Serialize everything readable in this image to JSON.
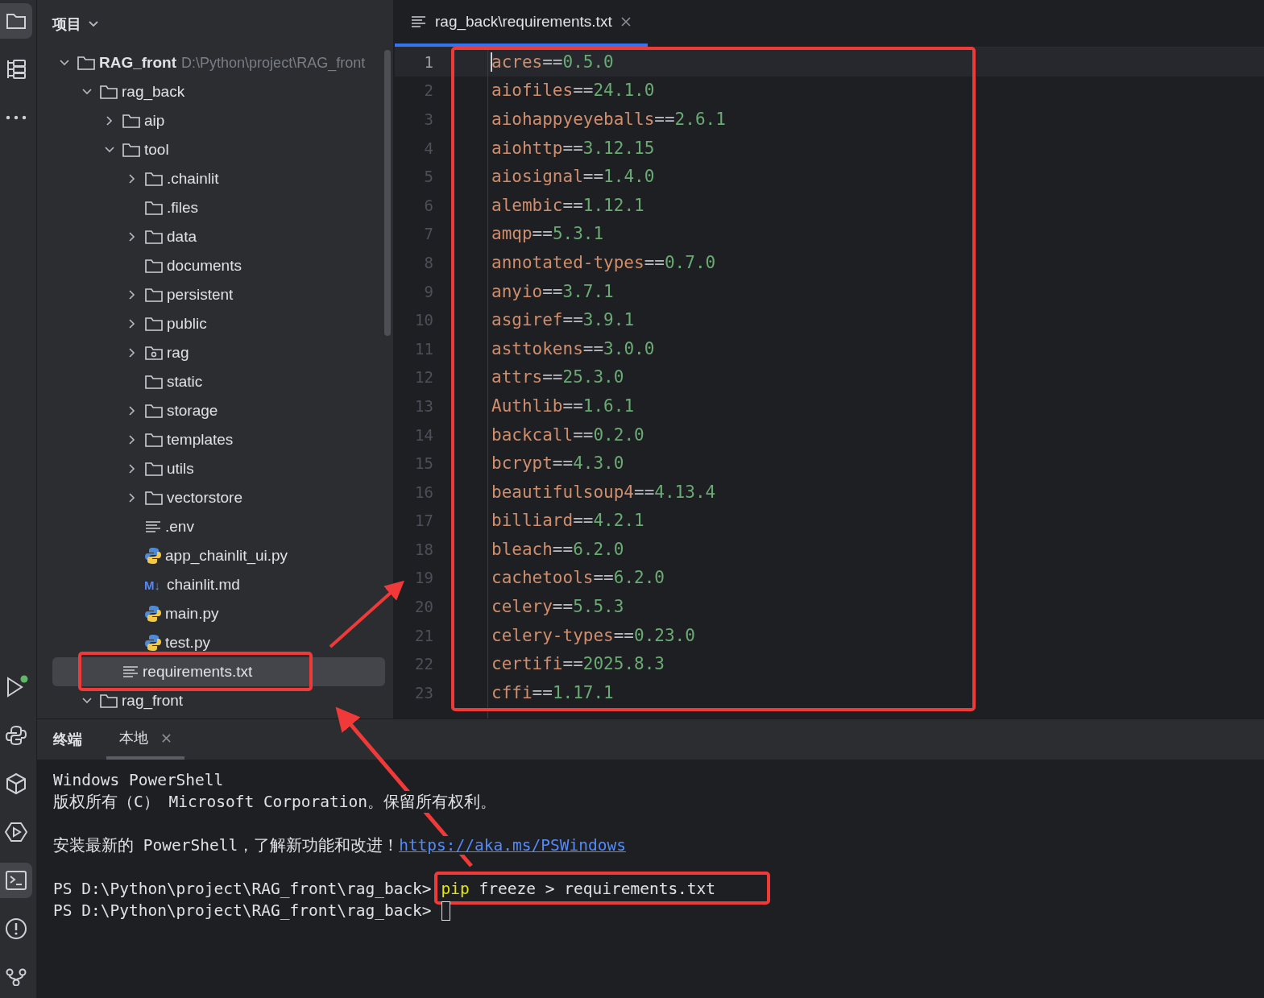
{
  "project_panel": {
    "title": "项目",
    "tree": [
      {
        "name": "RAG_front",
        "path": "D:\\Python\\project\\RAG_front",
        "kind": "folder",
        "expanded": true,
        "selected": false,
        "children": [
          {
            "name": "rag_back",
            "kind": "folder",
            "expanded": true,
            "selected": false,
            "children": [
              {
                "name": "aip",
                "kind": "folder",
                "expanded": false,
                "selected": false
              },
              {
                "name": "tool",
                "kind": "folder",
                "expanded": true,
                "selected": false,
                "children": [
                  {
                    "name": ".chainlit",
                    "kind": "folder",
                    "expanded": false,
                    "selected": false
                  },
                  {
                    "name": ".files",
                    "kind": "folder",
                    "selected": false
                  },
                  {
                    "name": "data",
                    "kind": "folder",
                    "expanded": false,
                    "selected": false
                  },
                  {
                    "name": "documents",
                    "kind": "folder",
                    "selected": false
                  },
                  {
                    "name": "persistent",
                    "kind": "folder",
                    "expanded": false,
                    "selected": false
                  },
                  {
                    "name": "public",
                    "kind": "folder",
                    "expanded": false,
                    "selected": false
                  },
                  {
                    "name": "rag",
                    "kind": "package",
                    "expanded": false,
                    "selected": false
                  },
                  {
                    "name": "static",
                    "kind": "folder",
                    "selected": false
                  },
                  {
                    "name": "storage",
                    "kind": "folder",
                    "expanded": false,
                    "selected": false
                  },
                  {
                    "name": "templates",
                    "kind": "folder",
                    "expanded": false,
                    "selected": false
                  },
                  {
                    "name": "utils",
                    "kind": "folder",
                    "expanded": false,
                    "selected": false
                  },
                  {
                    "name": "vectorstore",
                    "kind": "folder",
                    "expanded": false,
                    "selected": false
                  },
                  {
                    "name": ".env",
                    "kind": "text",
                    "selected": false
                  },
                  {
                    "name": "app_chainlit_ui.py",
                    "kind": "python",
                    "selected": false
                  },
                  {
                    "name": "chainlit.md",
                    "kind": "markdown",
                    "badge": "M↓",
                    "selected": false
                  },
                  {
                    "name": "main.py",
                    "kind": "python",
                    "selected": false
                  },
                  {
                    "name": "test.py",
                    "kind": "python",
                    "selected": false
                  }
                ]
              },
              {
                "name": "requirements.txt",
                "kind": "text",
                "selected": true
              }
            ]
          },
          {
            "name": "rag_front",
            "kind": "folder",
            "expanded": true,
            "selected": false
          }
        ]
      }
    ]
  },
  "editor": {
    "tabs": [
      {
        "label": "rag_back\\requirements.txt",
        "selected": true
      }
    ],
    "lines": [
      {
        "number": "1",
        "package": "acres",
        "operator": "==",
        "version": "0.5.0",
        "current": true
      },
      {
        "number": "2",
        "package": "aiofiles",
        "operator": "==",
        "version": "24.1.0"
      },
      {
        "number": "3",
        "package": "aiohappyeyeballs",
        "operator": "==",
        "version": "2.6.1"
      },
      {
        "number": "4",
        "package": "aiohttp",
        "operator": "==",
        "version": "3.12.15"
      },
      {
        "number": "5",
        "package": "aiosignal",
        "operator": "==",
        "version": "1.4.0"
      },
      {
        "number": "6",
        "package": "alembic",
        "operator": "==",
        "version": "1.12.1"
      },
      {
        "number": "7",
        "package": "amqp",
        "operator": "==",
        "version": "5.3.1"
      },
      {
        "number": "8",
        "package": "annotated-types",
        "operator": "==",
        "version": "0.7.0"
      },
      {
        "number": "9",
        "package": "anyio",
        "operator": "==",
        "version": "3.7.1"
      },
      {
        "number": "10",
        "package": "asgiref",
        "operator": "==",
        "version": "3.9.1"
      },
      {
        "number": "11",
        "package": "asttokens",
        "operator": "==",
        "version": "3.0.0"
      },
      {
        "number": "12",
        "package": "attrs",
        "operator": "==",
        "version": "25.3.0"
      },
      {
        "number": "13",
        "package": "Authlib",
        "operator": "==",
        "version": "1.6.1"
      },
      {
        "number": "14",
        "package": "backcall",
        "operator": "==",
        "version": "0.2.0"
      },
      {
        "number": "15",
        "package": "bcrypt",
        "operator": "==",
        "version": "4.3.0"
      },
      {
        "number": "16",
        "package": "beautifulsoup4",
        "operator": "==",
        "version": "4.13.4"
      },
      {
        "number": "17",
        "package": "billiard",
        "operator": "==",
        "version": "4.2.1"
      },
      {
        "number": "18",
        "package": "bleach",
        "operator": "==",
        "version": "6.2.0"
      },
      {
        "number": "19",
        "package": "cachetools",
        "operator": "==",
        "version": "6.2.0"
      },
      {
        "number": "20",
        "package": "celery",
        "operator": "==",
        "version": "5.5.3"
      },
      {
        "number": "21",
        "package": "celery-types",
        "operator": "==",
        "version": "0.23.0"
      },
      {
        "number": "22",
        "package": "certifi",
        "operator": "==",
        "version": "2025.8.3"
      },
      {
        "number": "23",
        "package": "cffi",
        "operator": "==",
        "version": "1.17.1"
      }
    ]
  },
  "terminal": {
    "title": "终端",
    "tabs": [
      {
        "label": "本地",
        "selected": true
      }
    ],
    "lines": [
      {
        "kind": "text",
        "text": "Windows PowerShell"
      },
      {
        "kind": "text",
        "text": "版权所有（C） Microsoft Corporation。保留所有权利。"
      },
      {
        "kind": "blank"
      },
      {
        "kind": "link",
        "text": "安装最新的 PowerShell，了解新功能和改进！",
        "link": "https://aka.ms/PSWindows"
      },
      {
        "kind": "blank"
      },
      {
        "kind": "prompt",
        "prompt": "PS D:\\Python\\project\\RAG_front\\rag_back>",
        "command": "pip",
        "args": "freeze > requirements.txt"
      },
      {
        "kind": "prompt",
        "prompt": "PS D:\\Python\\project\\RAG_front\\rag_back>",
        "cursor": true
      }
    ]
  },
  "tool_strip": {
    "top": [
      {
        "kind": "project",
        "selected": true
      },
      {
        "kind": "structure",
        "selected": false
      },
      {
        "kind": "more",
        "selected": false
      }
    ],
    "bottom": [
      {
        "kind": "run",
        "selected": false
      },
      {
        "kind": "python",
        "selected": false
      },
      {
        "kind": "packages",
        "selected": false
      },
      {
        "kind": "services",
        "selected": false
      },
      {
        "kind": "terminal",
        "selected": true
      },
      {
        "kind": "problems",
        "selected": false
      },
      {
        "kind": "git",
        "selected": false
      }
    ]
  }
}
